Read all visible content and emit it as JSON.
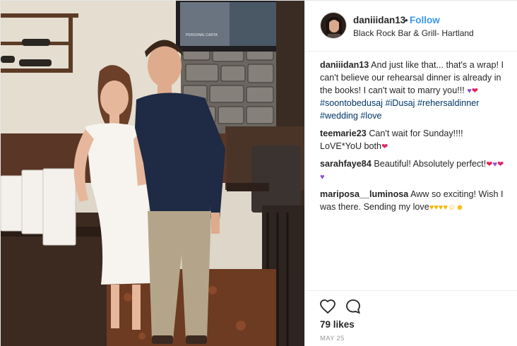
{
  "post": {
    "username": "daniiidan13",
    "separator": "•",
    "follow_label": "Follow",
    "location": "Black Rock Bar & Grill- Hartland",
    "photo_overlay": {
      "tv_caption": "PERSONAL CARTA"
    }
  },
  "caption": {
    "user": "daniiidan13",
    "text": "And just like that... that's a wrap! I can't believe our rehearsal dinner is already in the books! I can't wait to marry you!!!",
    "hashtags": [
      "#soontobedusaj",
      "#iDusaj",
      "#rehersaldinner",
      "#wedding",
      "#love"
    ]
  },
  "comments": [
    {
      "user": "teemarie23",
      "text_line1": "Can't wait for Sunday!!!!",
      "text_line2": "LoVE*YoU both"
    },
    {
      "user": "sarahfaye84",
      "text": "Beautiful! Absolutely perfect!"
    },
    {
      "user": "mariposa__luminosa",
      "text": "Aww so exciting! Wish I was there. Sending my love"
    }
  ],
  "footer": {
    "likes": "79 likes",
    "date": "MAY 25"
  },
  "icons": {
    "like": "heart-outline-icon",
    "comment": "speech-bubble-icon"
  },
  "colors": {
    "link_blue": "#3897f0",
    "hashtag": "#003569",
    "text": "#262626",
    "muted": "#999999"
  }
}
